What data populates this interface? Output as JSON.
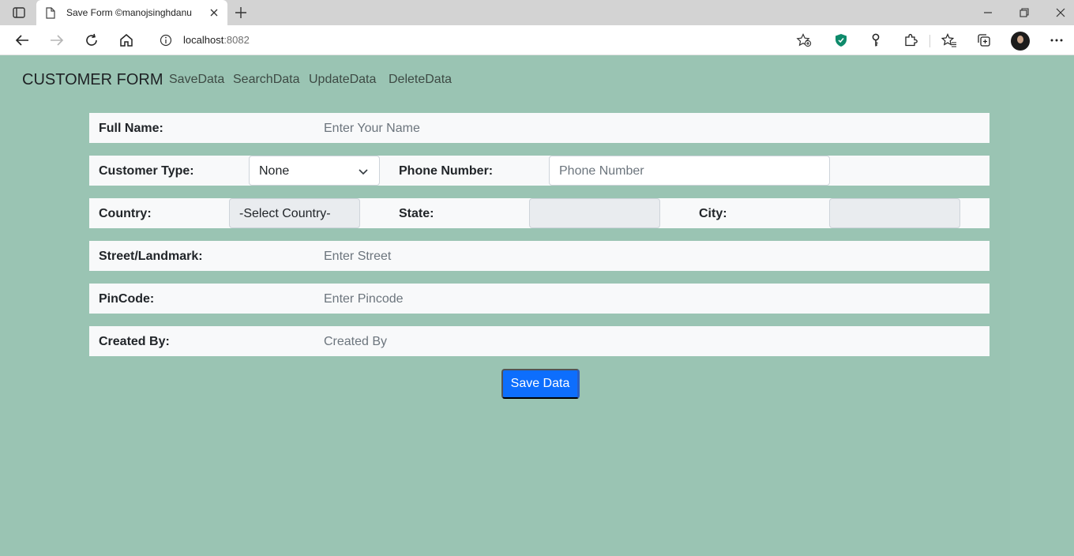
{
  "browser": {
    "tab_title": "Save Form ©manojsinghdanu",
    "url_host": "localhost",
    "url_port": ":8082"
  },
  "navbar": {
    "brand": "CUSTOMER FORM",
    "links": [
      "SaveData",
      "SearchData",
      "UpdateData",
      "DeleteData"
    ]
  },
  "form": {
    "full_name": {
      "label": "Full Name:",
      "placeholder": "Enter Your Name"
    },
    "customer_type": {
      "label": "Customer Type:",
      "value": "None"
    },
    "phone": {
      "label": "Phone Number:",
      "placeholder": "Phone Number"
    },
    "country": {
      "label": "Country:",
      "value": "-Select Country-"
    },
    "state": {
      "label": "State:",
      "value": ""
    },
    "city": {
      "label": "City:",
      "value": ""
    },
    "street": {
      "label": "Street/Landmark:",
      "placeholder": "Enter Street"
    },
    "pincode": {
      "label": "PinCode:",
      "placeholder": "Enter Pincode"
    },
    "created_by": {
      "label": "Created By:",
      "placeholder": "Created By"
    },
    "submit_label": "Save Data"
  },
  "colors": {
    "page_background": "#9ac4b3",
    "row_background": "#f8f9fa",
    "primary_button": "#0d6efd"
  },
  "icons": {
    "tab_actions": "tab-actions-icon",
    "favicon": "page-icon",
    "back": "back-arrow-icon",
    "forward": "forward-arrow-icon",
    "refresh": "refresh-icon",
    "home": "home-icon",
    "site_info": "info-icon",
    "add_favorite": "star-plus-icon",
    "shield": "shield-icon",
    "key": "key-icon",
    "extensions": "puzzle-icon",
    "favorites": "favorites-icon",
    "collections": "collections-icon",
    "more": "more-icon"
  }
}
